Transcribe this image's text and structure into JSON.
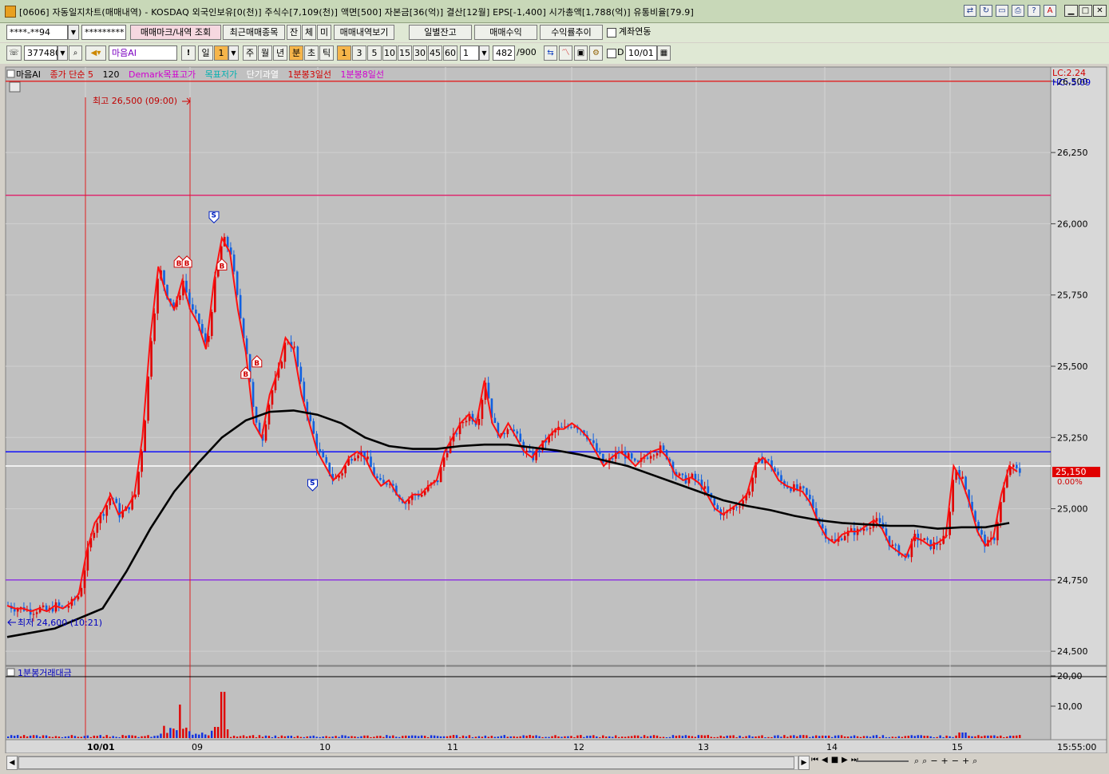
{
  "window": {
    "title": "[0606] 자동일지차트(매매내역) - KOSDAQ 외국인보유[0(천)] 주식수[7,109(천)] 액면[500] 자본금[36(억)] 결산[12월] EPS[-1,400] 시가총액[1,788(억)] 유통비율[79.9]"
  },
  "toolbar1": {
    "account": "****-**94",
    "password": "*********",
    "btn_markers": "매매마크/내역 조회",
    "btn_recent": "최근매매종목",
    "btn_jan": "잔",
    "btn_che": "체",
    "btn_mi": "미",
    "btn_history": "매매내역보기",
    "btn_daily_balance": "일별잔고",
    "btn_profit": "매매수익",
    "btn_return_trend": "수익률추이",
    "link_account_label": "계좌연동"
  },
  "toolbar2": {
    "code": "377480",
    "name": "마음AI",
    "period_day": "일",
    "period_day_count": "1",
    "period_week": "주",
    "period_month": "월",
    "period_year": "년",
    "period_min": "분",
    "period_sec": "초",
    "period_tick": "틱",
    "interval_options": [
      "1",
      "3",
      "5",
      "10",
      "15",
      "30",
      "45",
      "60"
    ],
    "interval_selected": "1",
    "multiplier": "1",
    "count_current": "482",
    "count_total": "/900",
    "d_label": "D",
    "date": "10/01"
  },
  "legend": {
    "items": [
      {
        "label": "마음AI",
        "color": "#000000"
      },
      {
        "label": "종가 단순 5",
        "color": "#d00000"
      },
      {
        "label": "120",
        "color": "#000000"
      },
      {
        "label": "Demark목표고가",
        "color": "#d000d0"
      },
      {
        "label": "목표저가",
        "color": "#00b0b0"
      },
      {
        "label": "단기과열",
        "color": "#ffffff"
      },
      {
        "label": "1분봉3일선",
        "color": "#d00000"
      },
      {
        "label": "1분봉8일선",
        "color": "#d000d0"
      }
    ]
  },
  "price_panel": {
    "lc": "LC:2.24",
    "hc": "HC:-5.09",
    "y_ticks": [
      "26,500",
      "26,250",
      "26,000",
      "25,750",
      "25,500",
      "25,250",
      "25,000",
      "24,750",
      "24,500"
    ],
    "current_price": "25,150",
    "current_change": "0.00%",
    "high_label": "최고 26,500 (09:00)",
    "low_label": "최저 24,600 (10:21)"
  },
  "volume_panel": {
    "title": "1분봉거래대금",
    "y_ticks": [
      "20,00",
      "10,00"
    ]
  },
  "x_axis": {
    "labels": [
      "10/01",
      "09",
      "10",
      "11",
      "12",
      "13",
      "14",
      "15"
    ],
    "time": "15:55:00"
  },
  "chart_data": {
    "type": "candlestick",
    "y_range": [
      24450,
      26550
    ],
    "reference_lines": [
      {
        "value": 26500,
        "color": "#e02020"
      },
      {
        "value": 26100,
        "color": "#e0206a"
      },
      {
        "value": 25200,
        "color": "#0000ff"
      },
      {
        "value": 25150,
        "color": "#ffffff"
      },
      {
        "value": 24750,
        "color": "#8a2be2"
      }
    ],
    "close_series_points": [
      [
        0,
        24660
      ],
      [
        5,
        24650
      ],
      [
        10,
        24650
      ],
      [
        15,
        24640
      ],
      [
        20,
        24650
      ],
      [
        25,
        24640
      ],
      [
        30,
        24660
      ],
      [
        35,
        24650
      ],
      [
        40,
        24670
      ],
      [
        45,
        24700
      ],
      [
        50,
        24850
      ],
      [
        55,
        24950
      ],
      [
        60,
        24990
      ],
      [
        65,
        25050
      ],
      [
        70,
        24980
      ],
      [
        75,
        25000
      ],
      [
        80,
        25050
      ],
      [
        85,
        25250
      ],
      [
        90,
        25600
      ],
      [
        95,
        25850
      ],
      [
        100,
        25750
      ],
      [
        105,
        25700
      ],
      [
        110,
        25800
      ],
      [
        115,
        25700
      ],
      [
        120,
        25650
      ],
      [
        125,
        25560
      ],
      [
        130,
        25800
      ],
      [
        135,
        25950
      ],
      [
        140,
        25900
      ],
      [
        145,
        25700
      ],
      [
        150,
        25550
      ],
      [
        155,
        25300
      ],
      [
        160,
        25250
      ],
      [
        165,
        25400
      ],
      [
        170,
        25480
      ],
      [
        175,
        25600
      ],
      [
        180,
        25560
      ],
      [
        185,
        25400
      ],
      [
        190,
        25300
      ],
      [
        195,
        25200
      ],
      [
        200,
        25150
      ],
      [
        205,
        25100
      ],
      [
        210,
        25130
      ],
      [
        215,
        25180
      ],
      [
        220,
        25200
      ],
      [
        225,
        25180
      ],
      [
        230,
        25120
      ],
      [
        235,
        25080
      ],
      [
        240,
        25100
      ],
      [
        245,
        25050
      ],
      [
        250,
        25020
      ],
      [
        255,
        25050
      ],
      [
        260,
        25050
      ],
      [
        265,
        25080
      ],
      [
        270,
        25100
      ],
      [
        275,
        25200
      ],
      [
        280,
        25250
      ],
      [
        285,
        25300
      ],
      [
        290,
        25330
      ],
      [
        295,
        25300
      ],
      [
        300,
        25450
      ],
      [
        305,
        25300
      ],
      [
        310,
        25250
      ],
      [
        315,
        25300
      ],
      [
        320,
        25250
      ],
      [
        325,
        25200
      ],
      [
        330,
        25180
      ],
      [
        335,
        25220
      ],
      [
        340,
        25250
      ],
      [
        345,
        25280
      ],
      [
        350,
        25280
      ],
      [
        355,
        25300
      ],
      [
        360,
        25280
      ],
      [
        365,
        25250
      ],
      [
        370,
        25200
      ],
      [
        375,
        25150
      ],
      [
        380,
        25180
      ],
      [
        385,
        25200
      ],
      [
        390,
        25180
      ],
      [
        395,
        25150
      ],
      [
        400,
        25180
      ],
      [
        405,
        25200
      ],
      [
        410,
        25210
      ],
      [
        415,
        25180
      ],
      [
        420,
        25120
      ],
      [
        425,
        25100
      ],
      [
        430,
        25110
      ],
      [
        435,
        25090
      ],
      [
        440,
        25050
      ],
      [
        445,
        25000
      ],
      [
        450,
        24980
      ],
      [
        455,
        25000
      ],
      [
        460,
        25020
      ],
      [
        465,
        25050
      ],
      [
        470,
        25150
      ],
      [
        475,
        25180
      ],
      [
        480,
        25150
      ],
      [
        485,
        25100
      ],
      [
        490,
        25080
      ],
      [
        495,
        25070
      ],
      [
        500,
        25060
      ],
      [
        505,
        25020
      ],
      [
        510,
        24950
      ],
      [
        515,
        24900
      ],
      [
        520,
        24880
      ],
      [
        525,
        24910
      ],
      [
        530,
        24920
      ],
      [
        535,
        24920
      ],
      [
        540,
        24940
      ],
      [
        545,
        24960
      ],
      [
        550,
        24930
      ],
      [
        555,
        24870
      ],
      [
        560,
        24850
      ],
      [
        565,
        24830
      ],
      [
        570,
        24900
      ],
      [
        575,
        24890
      ],
      [
        580,
        24870
      ],
      [
        585,
        24880
      ],
      [
        590,
        24900
      ],
      [
        595,
        25150
      ],
      [
        600,
        25100
      ],
      [
        605,
        25020
      ],
      [
        610,
        24920
      ],
      [
        615,
        24870
      ],
      [
        620,
        24900
      ],
      [
        625,
        25050
      ],
      [
        630,
        25150
      ],
      [
        635,
        25130
      ]
    ],
    "ma120_points": [
      [
        0,
        24550
      ],
      [
        30,
        24580
      ],
      [
        60,
        24650
      ],
      [
        75,
        24780
      ],
      [
        90,
        24930
      ],
      [
        105,
        25060
      ],
      [
        120,
        25160
      ],
      [
        135,
        25250
      ],
      [
        150,
        25310
      ],
      [
        165,
        25340
      ],
      [
        180,
        25345
      ],
      [
        195,
        25330
      ],
      [
        210,
        25300
      ],
      [
        225,
        25250
      ],
      [
        240,
        25220
      ],
      [
        255,
        25210
      ],
      [
        270,
        25210
      ],
      [
        285,
        25220
      ],
      [
        300,
        25225
      ],
      [
        315,
        25225
      ],
      [
        330,
        25215
      ],
      [
        345,
        25205
      ],
      [
        360,
        25190
      ],
      [
        375,
        25170
      ],
      [
        390,
        25150
      ],
      [
        405,
        25120
      ],
      [
        420,
        25090
      ],
      [
        435,
        25060
      ],
      [
        450,
        25030
      ],
      [
        465,
        25010
      ],
      [
        480,
        24995
      ],
      [
        495,
        24975
      ],
      [
        510,
        24960
      ],
      [
        525,
        24950
      ],
      [
        540,
        24945
      ],
      [
        555,
        24940
      ],
      [
        570,
        24940
      ],
      [
        585,
        24930
      ],
      [
        600,
        24935
      ],
      [
        615,
        24935
      ],
      [
        630,
        24950
      ]
    ],
    "markers": [
      {
        "type": "B",
        "i": 108,
        "value": 25870
      },
      {
        "type": "B",
        "i": 113,
        "value": 25870
      },
      {
        "type": "S",
        "i": 130,
        "value": 26020
      },
      {
        "type": "B",
        "i": 135,
        "value": 25860
      },
      {
        "type": "B",
        "i": 150,
        "value": 25480
      },
      {
        "type": "B",
        "i": 157,
        "value": 25520
      },
      {
        "type": "S",
        "i": 192,
        "value": 25080
      }
    ],
    "max_index": 640
  }
}
